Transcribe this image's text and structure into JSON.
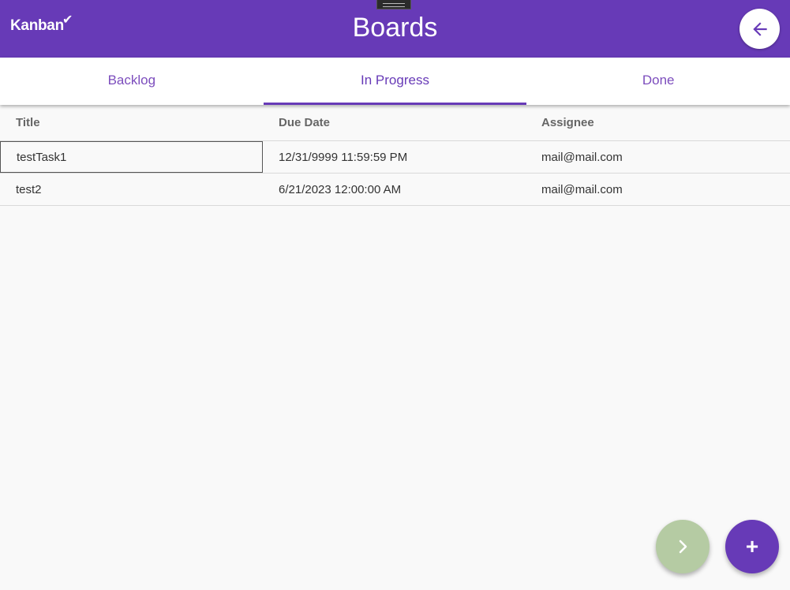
{
  "header": {
    "logo_text": "Kanban",
    "logo_check": "✔",
    "title": "Boards"
  },
  "tabs": [
    {
      "label": "Backlog",
      "active": false
    },
    {
      "label": "In Progress",
      "active": true
    },
    {
      "label": "Done",
      "active": false
    }
  ],
  "table": {
    "columns": [
      "Title",
      "Due Date",
      "Assignee"
    ],
    "rows": [
      {
        "title": "testTask1",
        "due_date": "12/31/9999 11:59:59 PM",
        "assignee": "mail@mail.com"
      },
      {
        "title": "test2",
        "due_date": "6/21/2023 12:00:00 AM",
        "assignee": "mail@mail.com"
      }
    ]
  },
  "fab": {
    "add_label": "+"
  },
  "colors": {
    "primary": "#673ab7",
    "fab_next": "#b5cba3"
  }
}
